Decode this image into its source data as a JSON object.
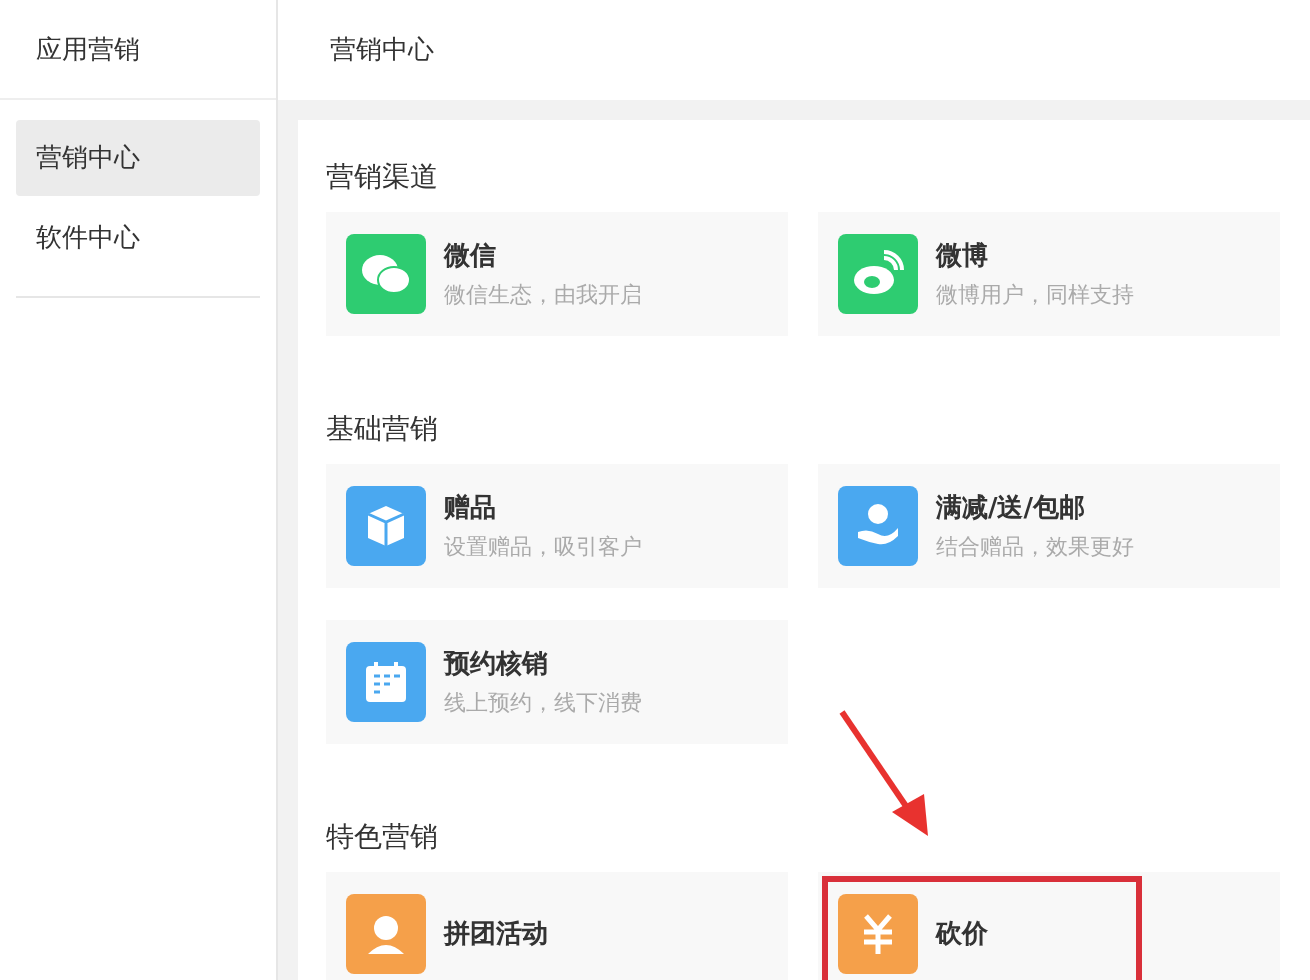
{
  "sidebar": {
    "title": "应用营销",
    "items": [
      {
        "label": "营销中心",
        "selected": true
      },
      {
        "label": "软件中心",
        "selected": false
      }
    ]
  },
  "header": {
    "title": "营销中心"
  },
  "sections": [
    {
      "heading": "营销渠道",
      "cards": [
        {
          "kind": "wechat",
          "color": "#2ecc71",
          "title": "微信",
          "subtitle": "微信生态，由我开启",
          "highlighted": false
        },
        {
          "kind": "weibo",
          "color": "#2ecc71",
          "title": "微博",
          "subtitle": "微博用户，同样支持",
          "highlighted": false
        }
      ]
    },
    {
      "heading": "基础营销",
      "cards": [
        {
          "kind": "gift",
          "color": "#4aa8f0",
          "title": "赠品",
          "subtitle": "设置赠品，吸引客户",
          "highlighted": false
        },
        {
          "kind": "discount",
          "color": "#4aa8f0",
          "title": "满减/送/包邮",
          "subtitle": "结合赠品，效果更好",
          "highlighted": false
        },
        {
          "kind": "booking",
          "color": "#4aa8f0",
          "title": "预约核销",
          "subtitle": "线上预约，线下消费",
          "highlighted": false
        }
      ]
    },
    {
      "heading": "特色营销",
      "cards": [
        {
          "kind": "group",
          "color": "#f5a04a",
          "title": "拼团活动",
          "highlighted": false
        },
        {
          "kind": "bargain",
          "color": "#f5a04a",
          "title": "砍价",
          "highlighted": true
        }
      ]
    }
  ]
}
